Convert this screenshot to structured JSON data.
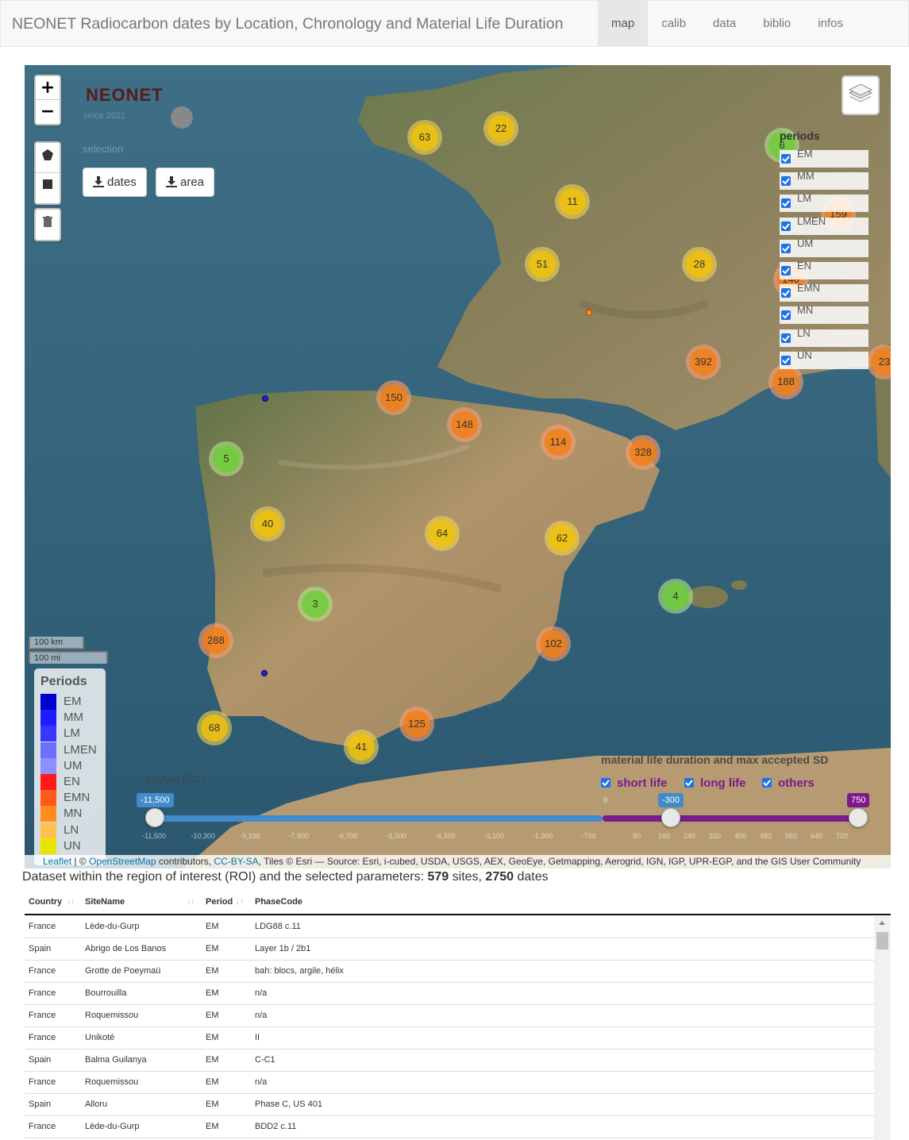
{
  "navbar": {
    "title": "NEONET Radiocarbon dates by Location, Chronology and Material Life Duration",
    "tabs": [
      {
        "label": "map",
        "active": true
      },
      {
        "label": "calib",
        "active": false
      },
      {
        "label": "data",
        "active": false
      },
      {
        "label": "biblio",
        "active": false
      },
      {
        "label": "infos",
        "active": false
      }
    ]
  },
  "map": {
    "logo": "NEONET",
    "logo_sub": "since 2021",
    "selection_label": "selection",
    "zoom_in": "+",
    "zoom_out": "−",
    "download_dates_label": "dates",
    "download_area_label": "area",
    "clusters": [
      {
        "count": "63",
        "color": "yellow"
      },
      {
        "count": "22",
        "color": "yellow"
      },
      {
        "count": "6",
        "color": "green"
      },
      {
        "count": "11",
        "color": "yellow"
      },
      {
        "count": "159",
        "color": "orange"
      },
      {
        "count": "51",
        "color": "yellow"
      },
      {
        "count": "28",
        "color": "yellow"
      },
      {
        "count": "140",
        "color": "orange"
      },
      {
        "count": "392",
        "color": "orange"
      },
      {
        "count": "23",
        "color": "orange"
      },
      {
        "count": "188",
        "color": "orange"
      },
      {
        "count": "150",
        "color": "orange"
      },
      {
        "count": "148",
        "color": "orange"
      },
      {
        "count": "114",
        "color": "orange"
      },
      {
        "count": "328",
        "color": "orange"
      },
      {
        "count": "5",
        "color": "green"
      },
      {
        "count": "40",
        "color": "yellow"
      },
      {
        "count": "64",
        "color": "yellow"
      },
      {
        "count": "62",
        "color": "yellow"
      },
      {
        "count": "3",
        "color": "green"
      },
      {
        "count": "4",
        "color": "green"
      },
      {
        "count": "288",
        "color": "orange"
      },
      {
        "count": "102",
        "color": "orange"
      },
      {
        "count": "125",
        "color": "orange"
      },
      {
        "count": "68",
        "color": "yellow"
      },
      {
        "count": "41",
        "color": "yellow"
      }
    ],
    "periods_filter": {
      "title": "periods",
      "items": [
        "EM",
        "MM",
        "LM",
        "LMEN",
        "UM",
        "EN",
        "EMN",
        "MN",
        "LN",
        "UN"
      ]
    },
    "legend": {
      "title": "Periods",
      "items": [
        {
          "label": "EM",
          "color": "#0000CF"
        },
        {
          "label": "MM",
          "color": "#1D1DFF"
        },
        {
          "label": "LM",
          "color": "#3737FF"
        },
        {
          "label": "LMEN",
          "color": "#6F6FFF"
        },
        {
          "label": "UM",
          "color": "#8F8FFF"
        },
        {
          "label": "EN",
          "color": "#FF1B1B"
        },
        {
          "label": "EMN",
          "color": "#FF5A1B"
        },
        {
          "label": "MN",
          "color": "#FF8C1B"
        },
        {
          "label": "LN",
          "color": "#FFC04D"
        },
        {
          "label": "UN",
          "color": "#E6E600"
        }
      ]
    },
    "scale": {
      "km": "100 km",
      "mi": "100 mi"
    },
    "material": {
      "title": "material life duration and max accepted SD",
      "options": [
        "short life",
        "long life",
        "others"
      ]
    },
    "tpq_label": "tpq/taq (BC)",
    "time_slider": {
      "min_badge": "-11,500",
      "ticks": [
        "-11,500",
        "-10,300",
        "-9,100",
        "-7,900",
        "-6,700",
        "-5,500",
        "-4,300",
        "-3,100",
        "-1,900",
        "-700"
      ]
    },
    "sd_slider": {
      "from_badge": "-300",
      "to_badge": "750",
      "zero": "0",
      "ticks": [
        "80",
        "160",
        "240",
        "320",
        "400",
        "480",
        "560",
        "640",
        "720"
      ]
    },
    "attribution": {
      "leaflet": "Leaflet",
      "sep": " | © ",
      "osm": "OpenStreetMap",
      "contrib": " contributors, ",
      "license": "CC-BY-SA",
      "tiles": ", Tiles © Esri — Source: Esri, i-cubed, USDA, USGS, AEX, GeoEye, Getmapping, Aerogrid, IGN, IGP, UPR-EGP, and the GIS User Community"
    }
  },
  "summary": {
    "prefix": "Dataset within the region of interest (ROI) and the selected parameters: ",
    "sites": "579",
    "sites_word": " sites, ",
    "dates": "2750",
    "dates_word": " dates"
  },
  "table": {
    "columns": [
      "Country",
      "SiteName",
      "Period",
      "PhaseCode"
    ],
    "rows": [
      [
        "France",
        "Lède-du-Gurp",
        "EM",
        "LDG88 c.11"
      ],
      [
        "Spain",
        "Abrigo de Los Banos",
        "EM",
        "Layer 1b / 2b1"
      ],
      [
        "France",
        "Grotte de Poeymaü",
        "EM",
        "bah: blocs, argile, hélix"
      ],
      [
        "France",
        "Bourrouilla",
        "EM",
        "n/a"
      ],
      [
        "France",
        "Roquemissou",
        "EM",
        "n/a"
      ],
      [
        "France",
        "Unikoté",
        "EM",
        "II"
      ],
      [
        "Spain",
        "Balma Guilanya",
        "EM",
        "C-C1"
      ],
      [
        "France",
        "Roquemissou",
        "EM",
        "n/a"
      ],
      [
        "Spain",
        "Alloru",
        "EM",
        "Phase C, US 401"
      ],
      [
        "France",
        "Lède-du-Gurp",
        "EM",
        "BDD2 c.11"
      ]
    ]
  },
  "colors": {
    "cluster_yellow": "#f1d357",
    "cluster_orange": "#fd9c73",
    "cluster_green": "#6ecc39",
    "slider_blue": "#428bca",
    "slider_purple": "#7b1a8c"
  }
}
